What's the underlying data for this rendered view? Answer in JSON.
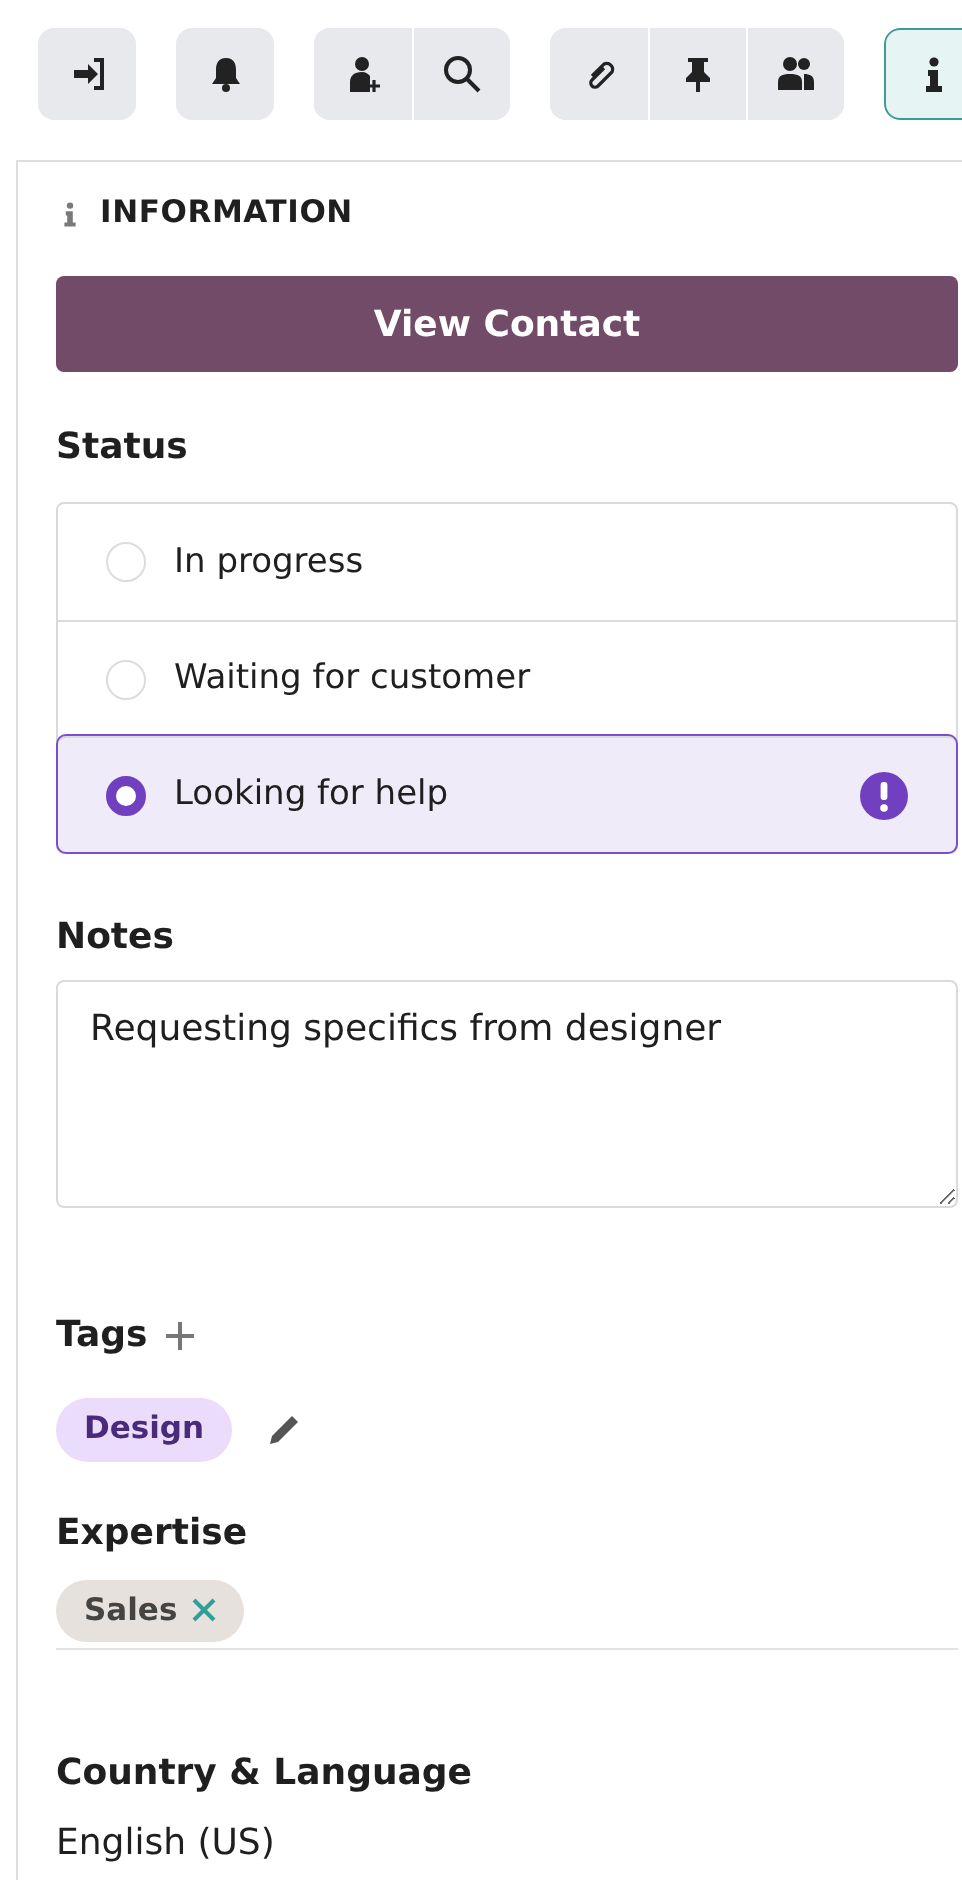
{
  "toolbar": {
    "groups": [
      {
        "buttons": [
          {
            "kind": "signin",
            "selected": false
          }
        ]
      },
      {
        "buttons": [
          {
            "kind": "bell",
            "selected": false
          }
        ]
      },
      {
        "buttons": [
          {
            "kind": "adduser",
            "selected": false
          },
          {
            "kind": "search",
            "selected": false
          }
        ]
      },
      {
        "buttons": [
          {
            "kind": "paperclip",
            "selected": false
          },
          {
            "kind": "pin",
            "selected": false
          },
          {
            "kind": "users",
            "selected": false
          }
        ]
      },
      {
        "buttons": [
          {
            "kind": "info",
            "selected": true
          }
        ]
      }
    ]
  },
  "panel": {
    "title": "INFORMATION",
    "action_button": "View Contact",
    "status": {
      "label": "Status",
      "options": [
        {
          "label": "In progress",
          "selected": false
        },
        {
          "label": "Waiting for customer",
          "selected": false
        },
        {
          "label": "Looking for help",
          "selected": true
        }
      ]
    },
    "notes": {
      "label": "Notes",
      "value": "Requesting specifics from designer"
    },
    "tags": {
      "label": "Tags",
      "items": [
        {
          "label": "Design",
          "color": "#ecdcfc"
        }
      ]
    },
    "expertise": {
      "label": "Expertise",
      "items": [
        {
          "label": "Sales",
          "color": "#e7e1de"
        }
      ]
    },
    "country_language": {
      "label": "Country & Language",
      "value": "English (US)"
    }
  }
}
